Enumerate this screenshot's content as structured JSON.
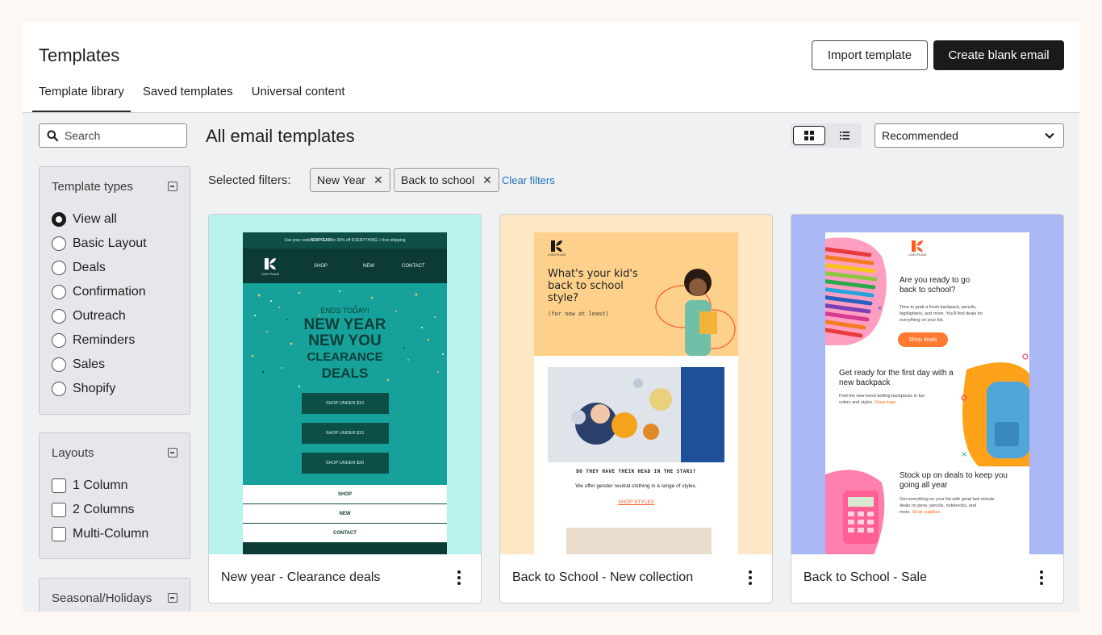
{
  "header": {
    "title": "Templates",
    "import_label": "Import template",
    "create_label": "Create blank email"
  },
  "tabs": [
    {
      "label": "Template library",
      "active": true
    },
    {
      "label": "Saved templates",
      "active": false
    },
    {
      "label": "Universal content",
      "active": false
    }
  ],
  "search": {
    "placeholder": "Search",
    "value": ""
  },
  "sidebar": {
    "template_types": {
      "title": "Template types",
      "options": [
        "View all",
        "Basic Layout",
        "Deals",
        "Confirmation",
        "Outreach",
        "Reminders",
        "Sales",
        "Shopify"
      ],
      "selected": "View all"
    },
    "layouts": {
      "title": "Layouts",
      "options": [
        "1 Column",
        "2 Columns",
        "Multi-Column"
      ]
    },
    "seasonal": {
      "title": "Seasonal/Holidays"
    }
  },
  "main": {
    "title": "All email templates",
    "sort_value": "Recommended",
    "filters_label": "Selected filters:",
    "filters": [
      "New Year",
      "Back to school"
    ],
    "clear_label": "Clear filters"
  },
  "cards": [
    {
      "title": "New year - Clearance deals",
      "preview": {
        "topline_a": "Use your code ",
        "topline_code": "NEWYEAR",
        "topline_b": " for 35% off EVERYTHING + free shipping",
        "logo": "LOGO PLACE",
        "nav": [
          "SHOP",
          "NEW",
          "CONTACT"
        ],
        "ends": "ENDS TODAY!",
        "headline": [
          "NEW YEAR",
          "NEW YOU",
          "CLEARANCE",
          "DEALS"
        ],
        "buttons": [
          "SHOP UNDER $10",
          "SHOP UNDER $15",
          "SHOP UNDER $20"
        ],
        "links": [
          "SHOP",
          "NEW",
          "CONTACT"
        ]
      }
    },
    {
      "title": "Back to School - New collection",
      "preview": {
        "logo": "LOGO PLACE",
        "headline": [
          "What's your kid's",
          "back to school",
          "style?"
        ],
        "sub": "(for now at least)",
        "question": "DO THEY HAVE THEIR HEAD IN THE STARS?",
        "body": "We offer gender neutral clothing in a range of styles.",
        "link": "SHOP STYLES"
      }
    },
    {
      "title": "Back to School - Sale",
      "preview": {
        "logo": "LOGO PLACE",
        "h1": [
          "Are you ready to go",
          "back to school?"
        ],
        "p1": [
          "Time to grab a fresh backpack, pencils,",
          "highlighters, and more. You'll find deals for",
          "everything on your list."
        ],
        "btn": "Shop deals",
        "h2": [
          "Get ready for the first day with a",
          "new backpack"
        ],
        "p2": [
          "Find the new trend-setting backpacks in fun",
          "colors and styles. "
        ],
        "p2_link": "Shop bags",
        "h3": [
          "Stock up on deals to keep you",
          "going all year"
        ],
        "p3": [
          "Get everything on your list with great last minute",
          "deals on pens, pencils, notebooks, and",
          "more. "
        ],
        "p3_link": "Shop supplies"
      }
    }
  ],
  "colors": {
    "page_bg": "#fdf8f3",
    "content_bg": "#f0f1f3",
    "primary_button": "#1a1a1a",
    "link": "#1f6fb5",
    "card1_bg": "#b9f3ef",
    "card2_bg": "#fde7c4",
    "card3_bg": "#a9b8f4"
  },
  "icons": [
    "search-icon",
    "collapse-icon",
    "grid-view-icon",
    "list-view-icon",
    "chevron-down-icon",
    "close-icon",
    "more-vertical-icon"
  ]
}
